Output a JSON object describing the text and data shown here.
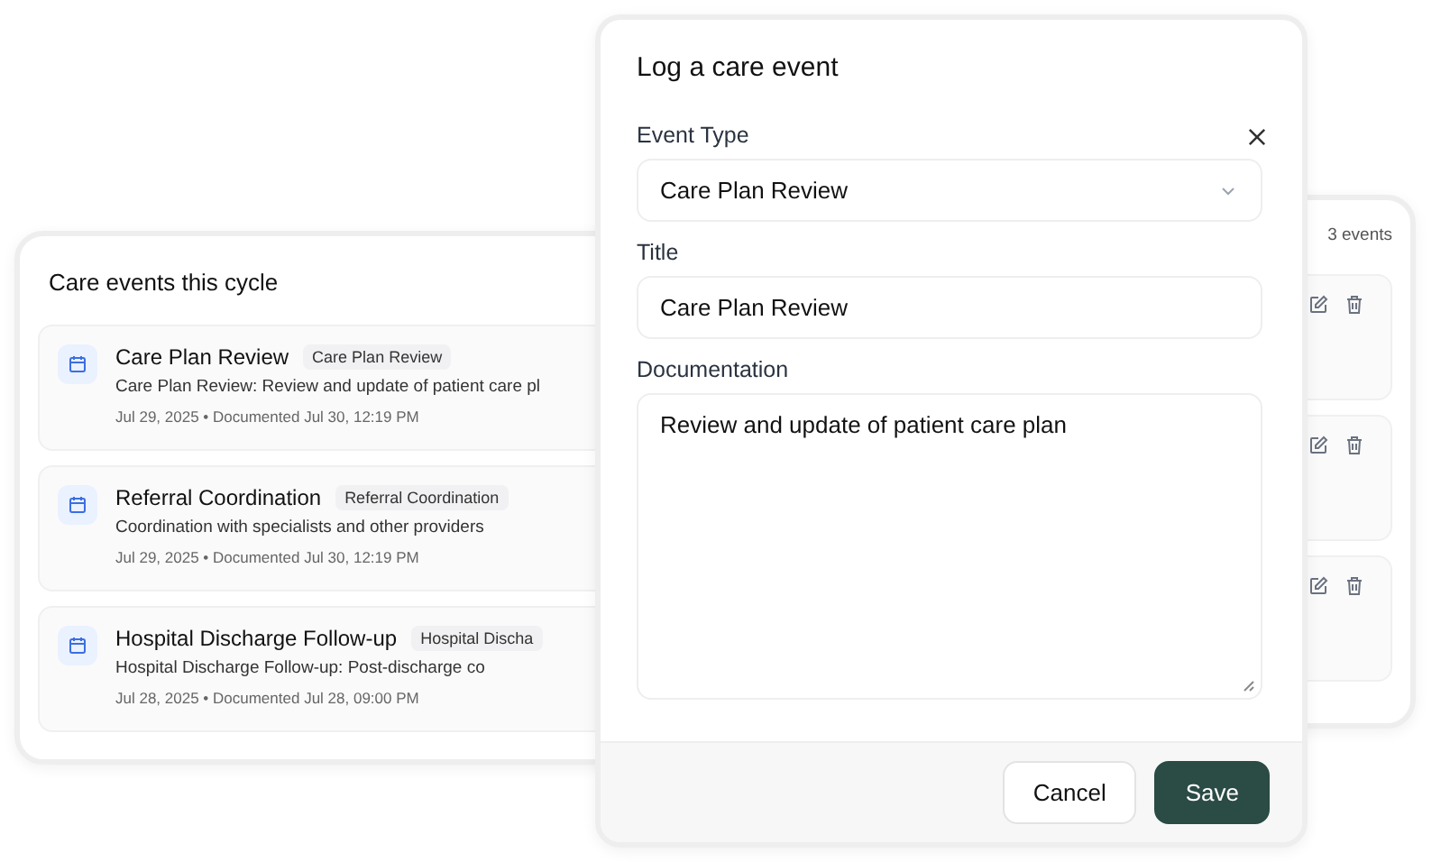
{
  "events_card": {
    "title": "Care events this cycle",
    "events": [
      {
        "title": "Care Plan Review",
        "tag": "Care Plan Review",
        "description": "Care Plan Review: Review and update of patient care pl",
        "meta": "Jul 29, 2025 • Documented Jul 30, 12:19 PM"
      },
      {
        "title": "Referral Coordination",
        "tag": "Referral Coordination",
        "description": "Coordination with specialists and other providers",
        "meta": "Jul 29, 2025 • Documented Jul 30, 12:19 PM"
      },
      {
        "title": "Hospital Discharge Follow-up",
        "tag": "Hospital Discha",
        "description": "Hospital Discharge Follow-up: Post-discharge co",
        "meta": "Jul 28, 2025 • Documented Jul 28, 09:00 PM"
      }
    ]
  },
  "side_card": {
    "count": "3 events",
    "rows": [
      {
        "editable": true,
        "deletable": true
      },
      {
        "editable": true,
        "deletable": true
      },
      {
        "editable": true,
        "deletable": true
      }
    ]
  },
  "dialog": {
    "title": "Log a care event",
    "fields": [
      {
        "kind": "select",
        "label": "Event Type",
        "value": "Care Plan Review"
      },
      {
        "kind": "text",
        "label": "Title",
        "value": "Care Plan Review"
      },
      {
        "kind": "textarea",
        "label": "Documentation",
        "value": "Review and update of patient care plan"
      }
    ],
    "buttons": [
      {
        "label": "Cancel",
        "kind": "secondary"
      },
      {
        "label": "Save",
        "kind": "primary"
      }
    ]
  }
}
